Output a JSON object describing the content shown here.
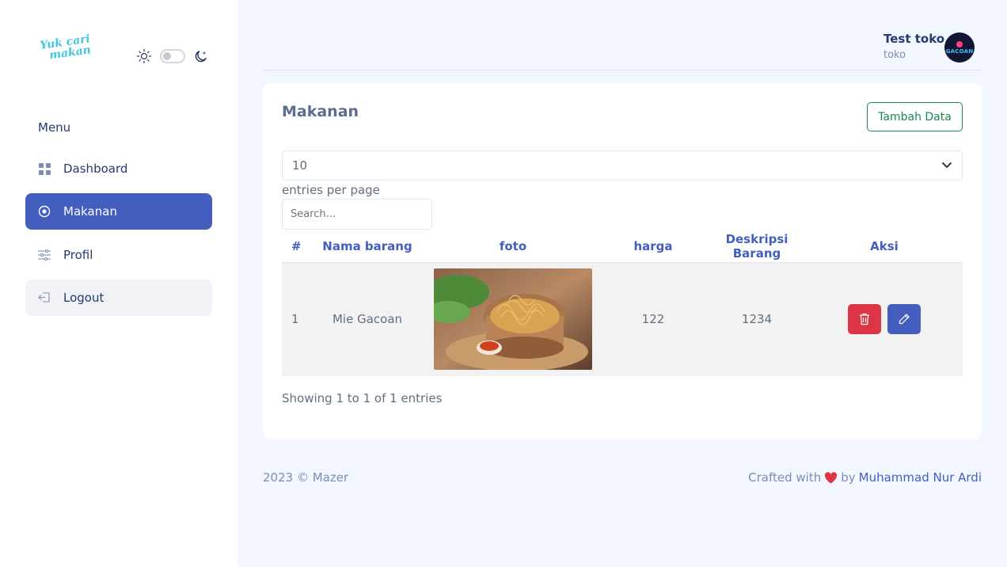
{
  "sidebar": {
    "logo_line1": "Yuk cari",
    "logo_line2": "makan",
    "menu_title": "Menu",
    "items": [
      {
        "label": "Dashboard",
        "icon": "grid-icon"
      },
      {
        "label": "Makanan",
        "icon": "food-icon",
        "active": true
      },
      {
        "label": "Profil",
        "icon": "sliders-icon"
      },
      {
        "label": "Logout",
        "icon": "logout-icon"
      }
    ]
  },
  "header": {
    "user_name": "Test toko",
    "user_role": "toko",
    "avatar_text": "GACOAN"
  },
  "card": {
    "title": "Makanan",
    "add_button": "Tambah Data",
    "per_page_value": "10",
    "per_page_label": "entries per page",
    "search_placeholder": "Search...",
    "columns": [
      "#",
      "Nama barang",
      "foto",
      "harga",
      "Deskripsi Barang",
      "Aksi"
    ],
    "rows": [
      {
        "num": "1",
        "name": "Mie Gacoan",
        "harga": "122",
        "deskripsi": "1234"
      }
    ],
    "showing_text": "Showing 1 to 1 of 1 entries"
  },
  "footer": {
    "left": "2023 © Mazer",
    "crafted": "Crafted with",
    "by": "by",
    "author": "Muhammad Nur Ardi"
  },
  "colors": {
    "primary": "#435ebe",
    "danger": "#dc3545",
    "success": "#198754",
    "background": "#f2f7ff"
  }
}
